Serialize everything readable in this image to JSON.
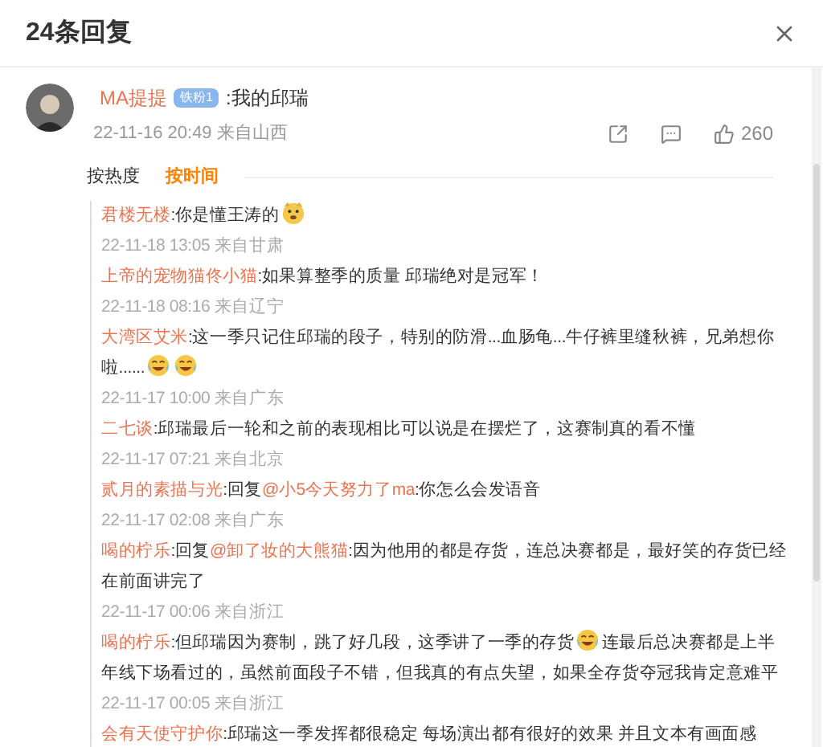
{
  "header": {
    "title": "24条回复"
  },
  "comment": {
    "name": "MA提提",
    "badge": "铁粉1",
    "text": ":我的邱瑞",
    "time": "22-11-16 20:49 来自山西",
    "likes": "260"
  },
  "sort_tabs": [
    {
      "label": "按热度",
      "selected": false
    },
    {
      "label": "按时间",
      "selected": true
    }
  ],
  "replies": [
    {
      "name": "君楼无楼",
      "parts": [
        {
          "kind": "text",
          "text": ":你是懂王涛的"
        },
        {
          "kind": "doge"
        }
      ],
      "time": "22-11-18 13:05 来自甘肃"
    },
    {
      "name": "上帝的宠物猫佟小猫",
      "parts": [
        {
          "kind": "text",
          "text": ":如果算整季的质量 邱瑞绝对是冠军！"
        }
      ],
      "time": "22-11-18 08:16 来自辽宁"
    },
    {
      "name": "大湾区艾米",
      "parts": [
        {
          "kind": "text",
          "text": ":这一季只记住邱瑞的段子，特别的防滑...血肠龟...牛仔裤里缝秋裤，兄弟想你啦......"
        },
        {
          "kind": "laughing"
        },
        {
          "kind": "laughing"
        }
      ],
      "time": "22-11-17 10:00 来自广东"
    },
    {
      "name": "二七谈",
      "parts": [
        {
          "kind": "text",
          "text": ":邱瑞最后一轮和之前的表现相比可以说是在摆烂了，这赛制真的看不懂"
        }
      ],
      "time": "22-11-17 07:21 来自北京"
    },
    {
      "name": "贰月的素描与光",
      "parts": [
        {
          "kind": "text",
          "text": ":回复"
        },
        {
          "kind": "mention",
          "text": "@小5今天努力了ma"
        },
        {
          "kind": "text",
          "text": ":你怎么会发语音"
        }
      ],
      "time": "22-11-17 02:08 来自广东"
    },
    {
      "name": "喝的柠乐",
      "parts": [
        {
          "kind": "text",
          "text": ":回复"
        },
        {
          "kind": "mention",
          "text": "@卸了妆的大熊猫"
        },
        {
          "kind": "text",
          "text": ":因为他用的都是存货，连总决赛都是，最好笑的存货已经在前面讲完了"
        }
      ],
      "time": "22-11-17 00:06 来自浙江"
    },
    {
      "name": "喝的柠乐",
      "parts": [
        {
          "kind": "text",
          "text": ":但邱瑞因为赛制，跳了好几段，这季讲了一季的存货"
        },
        {
          "kind": "laughing"
        },
        {
          "kind": "text",
          "text": "连最后总决赛都是上半年线下场看过的，虽然前面段子不错，但我真的有点失望，如果全存货夺冠我肯定意难平"
        }
      ],
      "time": "22-11-17 00:05 来自浙江"
    },
    {
      "name": "会有天使守护你",
      "parts": [
        {
          "kind": "text",
          "text": ":邱瑞这一季发挥都很稳定 每场演出都有很好的效果 并且文本有画面感"
        }
      ]
    }
  ]
}
